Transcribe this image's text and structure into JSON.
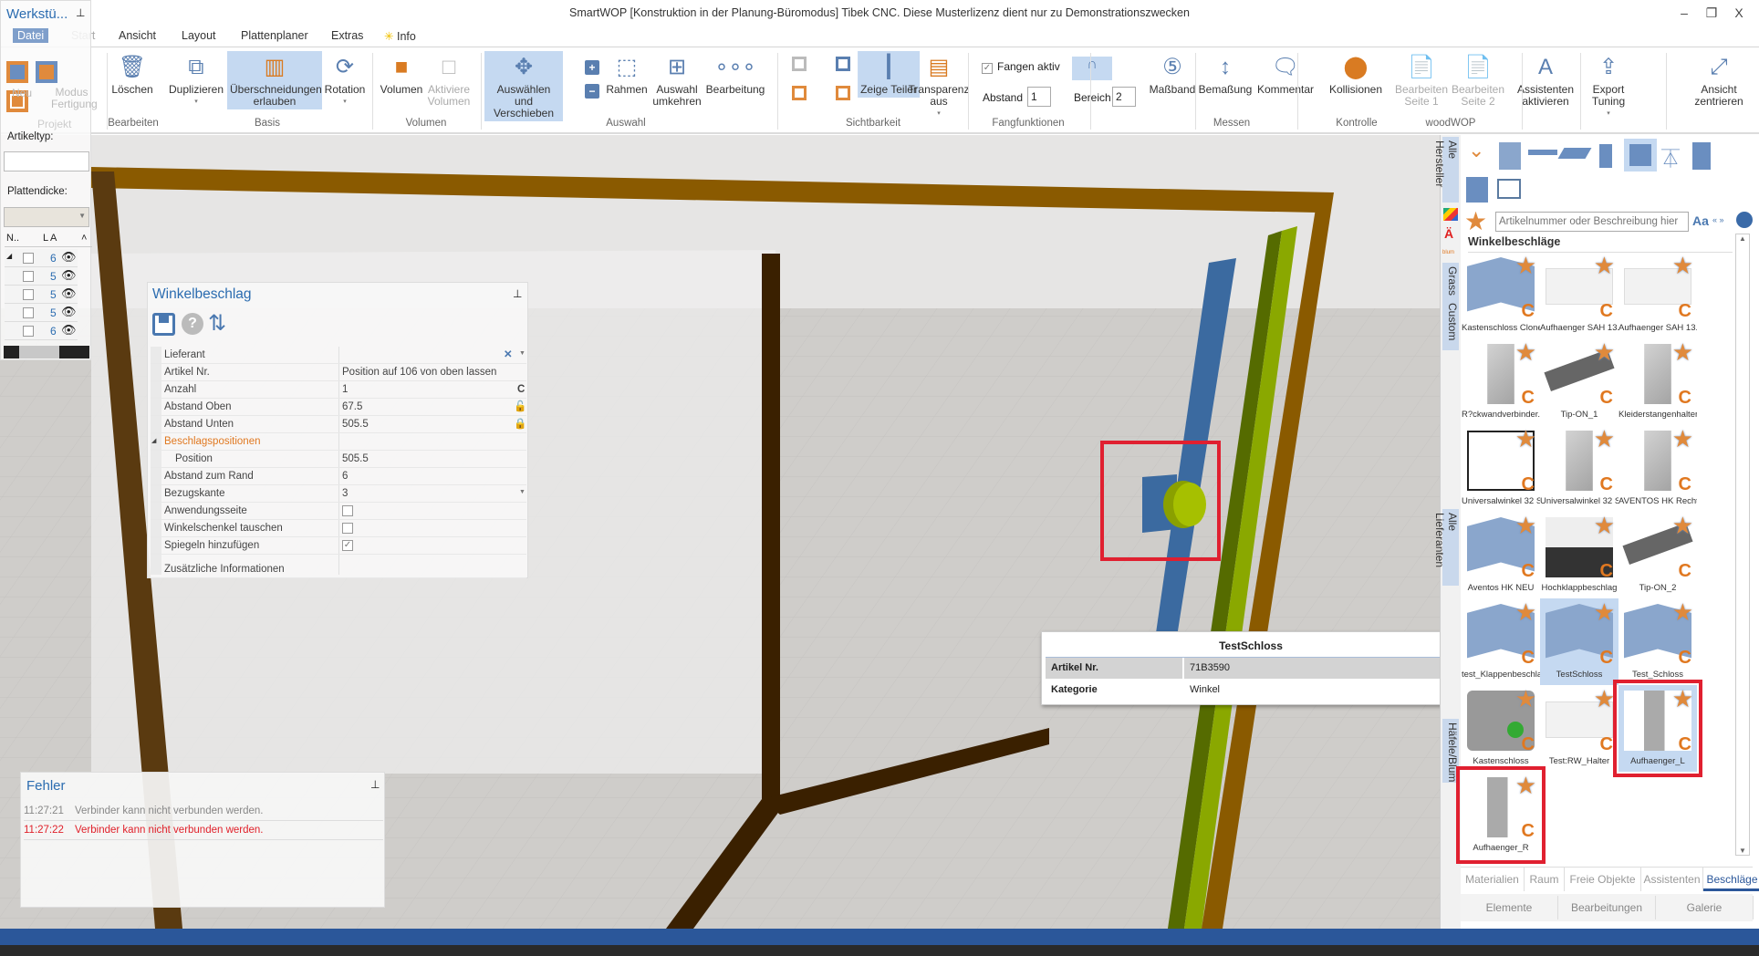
{
  "window": {
    "title": "SmartWOP [Konstruktion in der Planung-Büromodus] Tibek CNC. Diese Musterlizenz dient nur zu Demonstrationszwecken",
    "minimize": "–",
    "restore": "❐",
    "close": "X"
  },
  "tabs": [
    "Datei",
    "Start",
    "Ansicht",
    "Layout",
    "Plattenplaner",
    "Extras",
    "Info"
  ],
  "ribbon": {
    "buttons": [
      {
        "label": "Löschen",
        "icon": "trash-icon"
      },
      {
        "label": "Duplizieren",
        "icon": "duplicate-icon",
        "dropdown": true
      },
      {
        "label": "Überschneidungen erlauben",
        "icon": "overlap-icon",
        "active": true
      },
      {
        "label": "Rotation",
        "icon": "rotation-icon",
        "dropdown": true
      },
      {
        "label": "Volumen",
        "icon": "volume-icon"
      },
      {
        "label": "Aktiviere Volumen",
        "icon": "activate-volume-icon",
        "disabled": true
      },
      {
        "label": "Auswählen und Verschieben",
        "icon": "move-icon",
        "active": true
      },
      {
        "label": "Rahmen",
        "icon": "frame-select-icon"
      },
      {
        "label": "Auswahl umkehren",
        "icon": "invert-selection-icon"
      },
      {
        "label": "Bearbeitung",
        "icon": "machining-icon"
      },
      {
        "label": "Zeige Teiler",
        "icon": "divider-icon",
        "active": true
      },
      {
        "label": "Transparenz aus",
        "icon": "transparency-icon",
        "dropdown": true
      },
      {
        "label": "Maßband",
        "icon": "tape-measure-icon"
      },
      {
        "label": "Bemaßung",
        "icon": "dimension-icon"
      },
      {
        "label": "Kommentar",
        "icon": "comment-icon"
      },
      {
        "label": "Kollisionen",
        "icon": "collision-icon"
      },
      {
        "label": "Bearbeiten Seite 1",
        "icon": "mpr-icon",
        "disabled": true
      },
      {
        "label": "Bearbeiten Seite 2",
        "icon": "mpr-icon",
        "disabled": true
      },
      {
        "label": "Assistenten aktivieren",
        "icon": "assistant-icon"
      },
      {
        "label": "Export Tuning",
        "icon": "export-icon",
        "dropdown": true
      },
      {
        "label": "Ansicht zentrieren",
        "icon": "center-view-icon"
      }
    ],
    "groups": [
      "Bearbeiten",
      "Basis",
      "Volumen",
      "Auswahl",
      "Sichtbarkeit",
      "Fangfunktionen",
      "Messen",
      "Kontrolle",
      "woodWOP"
    ],
    "fangen": {
      "label": "Fangen aktiv",
      "checked": true,
      "abstand_label": "Abstand",
      "abstand": "1",
      "bereich_label": "Bereich",
      "bereich": "2"
    }
  },
  "left_panel": {
    "title": "Werkstü...",
    "project_buttons": [
      "Neu",
      "Modus Fertigung"
    ],
    "project_group": "Projekt",
    "artikeltyp_label": "Artikeltyp:",
    "plattendicke_label": "Plattendicke:",
    "columns": [
      "N..",
      "L",
      "A"
    ],
    "rows": [
      "6",
      "5",
      "5",
      "5",
      "6"
    ]
  },
  "props": {
    "title": "Winkelbeschlag",
    "rows": [
      {
        "k": "Lieferant",
        "v": ""
      },
      {
        "k": "Artikel Nr.",
        "v": "Position auf 106 von oben lassen"
      },
      {
        "k": "Anzahl",
        "v": "1"
      },
      {
        "k": "Abstand Oben",
        "v": "67.5"
      },
      {
        "k": "Abstand Unten",
        "v": "505.5"
      },
      {
        "k": "Beschlagspositionen",
        "v": "",
        "section": true
      },
      {
        "k": "Position",
        "v": "505.5",
        "indent": true
      },
      {
        "k": "Abstand zum Rand",
        "v": "6"
      },
      {
        "k": "Bezugskante",
        "v": "3"
      },
      {
        "k": "Anwendungsseite",
        "check": false
      },
      {
        "k": "Winkelschenkel tauschen",
        "check": false
      },
      {
        "k": "Spiegeln hinzufügen",
        "check": true
      },
      {
        "k": "Zusätzliche Informationen",
        "v": ""
      }
    ],
    "c_marker": "C"
  },
  "errors": {
    "title": "Fehler",
    "items": [
      {
        "time": "11:27:21",
        "msg": "Verbinder kann nicht verbunden werden.",
        "color": "#888888"
      },
      {
        "time": "11:27:22",
        "msg": "Verbinder kann nicht verbunden werden.",
        "color": "#e0202a"
      }
    ]
  },
  "tooltip": {
    "title": "TestSchloss",
    "rows": [
      {
        "k": "Artikel Nr.",
        "v": "71B3590"
      },
      {
        "k": "Kategorie",
        "v": "Winkel"
      }
    ]
  },
  "catalog": {
    "vertical_tabs": [
      "Alle Hersteller",
      "Grass",
      "Custom",
      "Alle Lieferanten",
      "Häfele/Blum"
    ],
    "search_placeholder": "Artikelnummer oder Beschreibung hier",
    "case_label": "Aa",
    "quote_label": "« »",
    "heading": "Winkelbeschläge",
    "items": [
      {
        "name": "Kastenschloss Clone",
        "kind": "bracket"
      },
      {
        "name": "Aufhaenger SAH 13...",
        "kind": "white"
      },
      {
        "name": "Aufhaenger SAH 13...",
        "kind": "white"
      },
      {
        "name": "R?ckwandverbinder...",
        "kind": "metal"
      },
      {
        "name": "Tip-ON_1",
        "kind": "gray"
      },
      {
        "name": "Kleiderstangenhalter",
        "kind": "metal"
      },
      {
        "name": "Universalwinkel 32 S...",
        "kind": "outline"
      },
      {
        "name": "Universalwinkel 32 S...",
        "kind": "metal"
      },
      {
        "name": "AVENTOS HK Rechts",
        "kind": "metal"
      },
      {
        "name": "Aventos HK NEU",
        "kind": "bracket"
      },
      {
        "name": "Hochklappbeschlag",
        "kind": "dark"
      },
      {
        "name": "Tip-ON_2",
        "kind": "gray"
      },
      {
        "name": "test_Klappenbeschlag",
        "kind": "bracket"
      },
      {
        "name": "TestSchloss",
        "kind": "bracket",
        "selected": true
      },
      {
        "name": "Test_Schloss",
        "kind": "bracket"
      },
      {
        "name": "Kastenschloss",
        "kind": "lock"
      },
      {
        "name": "Test:RW_Halter",
        "kind": "white"
      },
      {
        "name": "Aufhaenger_L",
        "kind": "hanger",
        "selected": true,
        "highlighted": true
      },
      {
        "name": "Aufhaenger_R",
        "kind": "hanger",
        "highlighted": true
      }
    ],
    "bottom_tabs": [
      {
        "label": "Materialien"
      },
      {
        "label": "Raum"
      },
      {
        "label": "Freie Objekte"
      },
      {
        "label": "Assistenten"
      },
      {
        "label": "Beschläge",
        "active": true
      }
    ],
    "bottom_buttons": [
      "Elemente",
      "Bearbeitungen",
      "Galerie"
    ]
  },
  "colors": {
    "accent": "#2b579a",
    "highlight": "#c5d9f1",
    "star": "#e08a3c",
    "error": "#e0202a",
    "frame_brown": "#8a5a00",
    "frame_dark": "#3a2000",
    "green": "#7a9a00"
  }
}
